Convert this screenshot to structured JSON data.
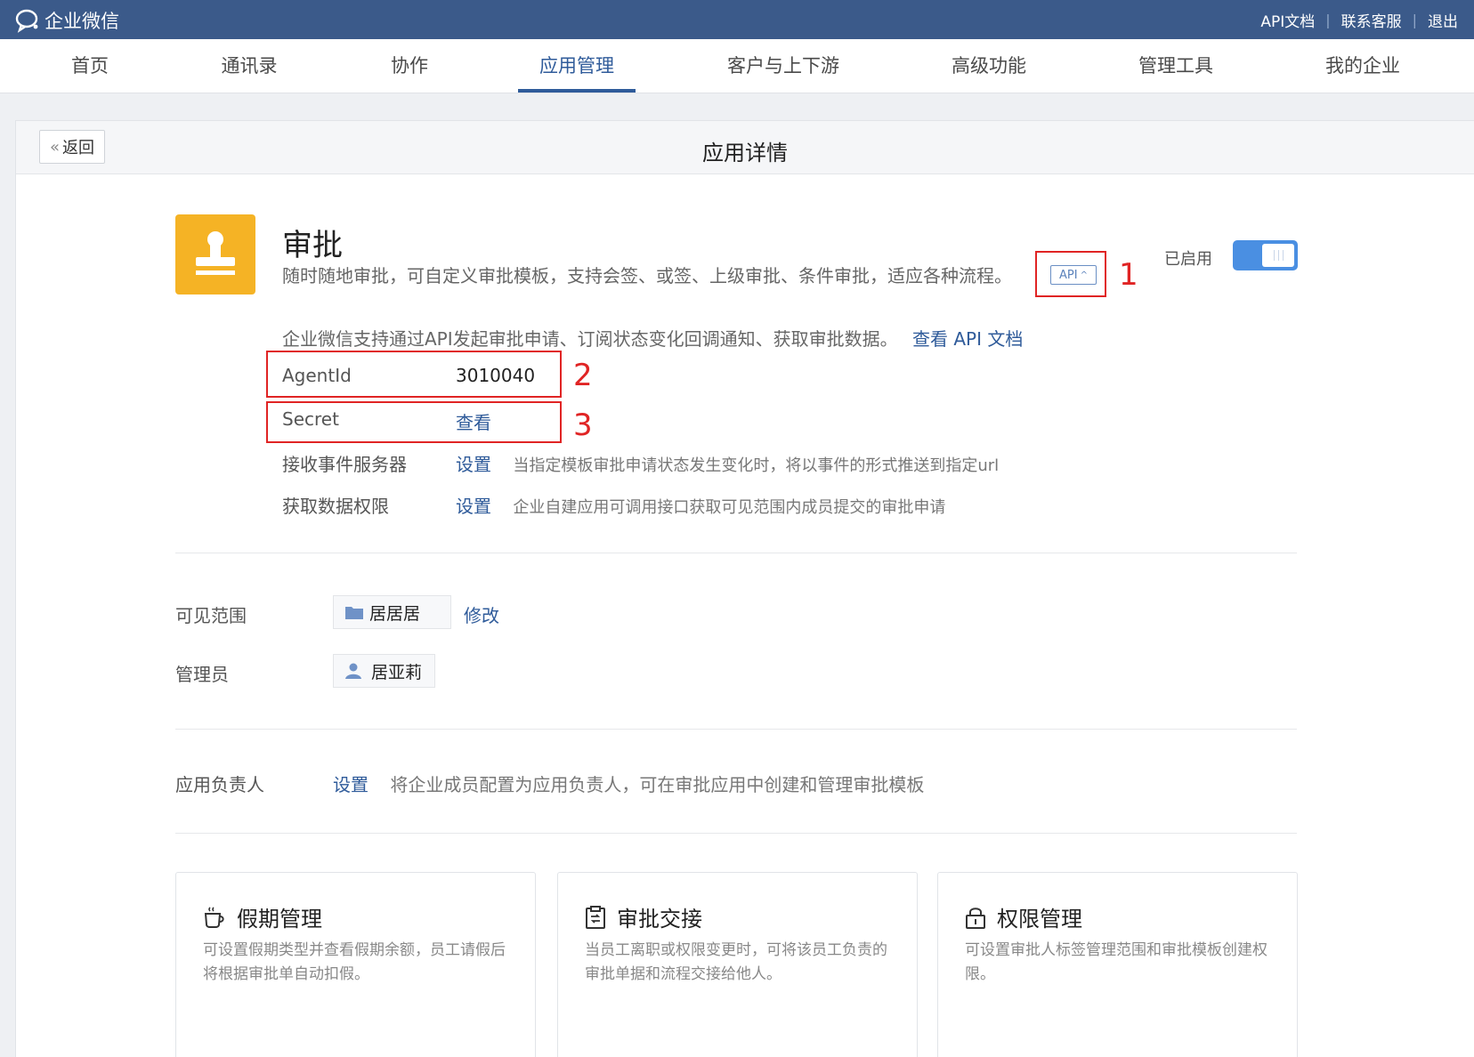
{
  "topbar": {
    "brand": "企业微信",
    "links": [
      "API文档",
      "联系客服",
      "退出"
    ]
  },
  "nav": {
    "items": [
      "首页",
      "通讯录",
      "协作",
      "应用管理",
      "客户与上下游",
      "高级功能",
      "管理工具",
      "我的企业"
    ],
    "active_index": 3
  },
  "panel": {
    "back_label": "返回",
    "title": "应用详情"
  },
  "app": {
    "name": "审批",
    "description": "随时随地审批，可自定义审批模板，支持会签、或签、上级审批、条件审批，适应各种流程。",
    "api_tag": "API",
    "status_label": "已启用",
    "enabled": true,
    "api_note": "企业微信支持通过API发起审批申请、订阅状态变化回调通知、获取审批数据。",
    "api_doc_link": "查看 API 文档"
  },
  "annotations": [
    "1",
    "2",
    "3"
  ],
  "fields": {
    "agentid_label": "AgentId",
    "agentid_value": "3010040",
    "secret_label": "Secret",
    "secret_link": "查看",
    "event_label": "接收事件服务器",
    "event_link": "设置",
    "event_desc": "当指定模板审批申请状态发生变化时，将以事件的形式推送到指定url",
    "perm_label": "获取数据权限",
    "perm_link": "设置",
    "perm_desc": "企业自建应用可调用接口获取可见范围内成员提交的审批申请"
  },
  "visibility": {
    "label": "可见范围",
    "chip": "居居居",
    "edit_link": "修改"
  },
  "admin": {
    "label": "管理员",
    "chip": "居亚莉"
  },
  "owner": {
    "label": "应用负责人",
    "link": "设置",
    "desc": "将企业成员配置为应用负责人，可在审批应用中创建和管理审批模板"
  },
  "cards": [
    {
      "title": "假期管理",
      "icon": "coffee-cup-icon",
      "desc": "可设置假期类型并查看假期余额，员工请假后将根据审批单自动扣假。"
    },
    {
      "title": "审批交接",
      "icon": "clipboard-icon",
      "desc": "当员工离职或权限变更时，可将该员工负责的审批单据和流程交接给他人。"
    },
    {
      "title": "权限管理",
      "icon": "lock-icon",
      "desc": "可设置审批人标签管理范围和审批模板创建权限。"
    }
  ],
  "colors": {
    "topbar": "#3b5a8a",
    "accent": "#2f5b9a",
    "app_icon": "#f5b325",
    "toggle": "#4a8fe2",
    "annotation_red": "#e02424"
  }
}
